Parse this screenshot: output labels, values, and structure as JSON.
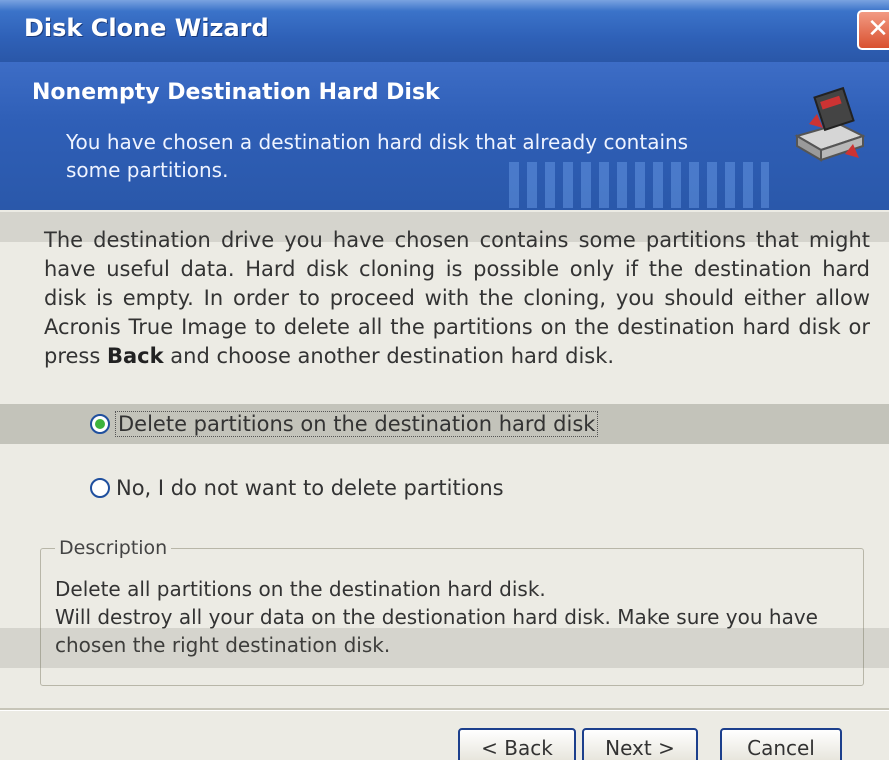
{
  "window": {
    "title": "Disk Clone Wizard",
    "close_symbol": "✕"
  },
  "header": {
    "title": "Nonempty Destination Hard Disk",
    "subtitle": "You have chosen a destination hard disk that already contains some partitions.",
    "icon": "hard-disk-icon"
  },
  "body": {
    "text_before": "The destination drive you have chosen contains some partitions that might have useful data. Hard disk cloning is possible only if the destination hard disk is empty. In order to proceed with the cloning, you should either allow Acronis True Image to delete all the partitions on the destination hard disk or press",
    "text_bold": "Back",
    "text_after": "and choose another destination hard disk."
  },
  "options": [
    {
      "label": "Delete partitions on the destination hard disk",
      "selected": true
    },
    {
      "label": "No, I do not want to delete partitions",
      "selected": false
    }
  ],
  "description": {
    "legend": "Description",
    "line1": "Delete all partitions on the destination hard disk.",
    "line2": "Will destroy all your data on the destionation hard disk. Make sure you have chosen the right destination disk."
  },
  "buttons": {
    "back": "< Back",
    "next": "Next >",
    "cancel": "Cancel"
  },
  "colors": {
    "accent": "#2f5fb7",
    "radio_selected": "#3db33d"
  }
}
